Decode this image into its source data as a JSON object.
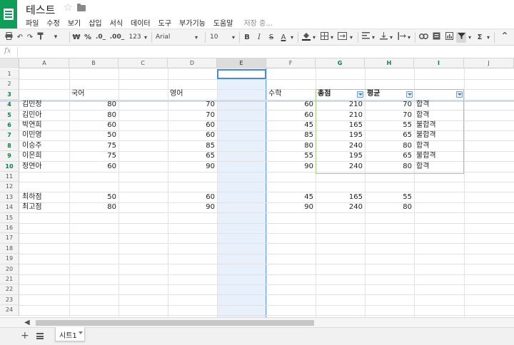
{
  "doc": {
    "title": "테스트"
  },
  "menu": [
    {
      "label": "파일"
    },
    {
      "label": "수정"
    },
    {
      "label": "보기"
    },
    {
      "label": "삽입"
    },
    {
      "label": "서식"
    },
    {
      "label": "데이터"
    },
    {
      "label": "도구"
    },
    {
      "label": "부가기능"
    },
    {
      "label": "도움말"
    }
  ],
  "status": "저장 중...",
  "toolbar": {
    "currency": "₩",
    "percent": "%",
    "dec_decrease": ".0_",
    "dec_increase": ".00_",
    "format_more": "123",
    "font": "Arial",
    "size": "10",
    "bold": "B",
    "italic": "I",
    "strike": "S",
    "text_color": "A",
    "sum": "Σ"
  },
  "formula": {
    "fx": "fx",
    "value": ""
  },
  "columns": [
    "A",
    "B",
    "C",
    "D",
    "E",
    "F",
    "G",
    "H",
    "I",
    "J"
  ],
  "rows": [
    "1",
    "2",
    "3",
    "4",
    "5",
    "6",
    "7",
    "8",
    "9",
    "10",
    "11",
    "12",
    "13",
    "14",
    "15",
    "16",
    "17",
    "18",
    "19",
    "20",
    "21",
    "22",
    "23",
    "24"
  ],
  "headers": {
    "korean": "국어",
    "english": "영어",
    "math": "수학",
    "total": "총점",
    "average": "평균"
  },
  "students": [
    {
      "name": "김민정",
      "korean": "80",
      "english": "70",
      "math": "60",
      "total": "210",
      "average": "70",
      "result": "합격"
    },
    {
      "name": "김민아",
      "korean": "80",
      "english": "70",
      "math": "60",
      "total": "210",
      "average": "70",
      "result": "합격"
    },
    {
      "name": "박연희",
      "korean": "60",
      "english": "60",
      "math": "45",
      "total": "165",
      "average": "55",
      "result": "불합격"
    },
    {
      "name": "이민영",
      "korean": "50",
      "english": "60",
      "math": "85",
      "total": "195",
      "average": "65",
      "result": "불합격"
    },
    {
      "name": "이승주",
      "korean": "75",
      "english": "85",
      "math": "80",
      "total": "240",
      "average": "80",
      "result": "합격"
    },
    {
      "name": "이은희",
      "korean": "75",
      "english": "65",
      "math": "55",
      "total": "195",
      "average": "65",
      "result": "불합격"
    },
    {
      "name": "정연아",
      "korean": "60",
      "english": "90",
      "math": "90",
      "total": "240",
      "average": "80",
      "result": "합격"
    }
  ],
  "stats": [
    {
      "label": "최하점",
      "korean": "50",
      "english": "60",
      "math": "45",
      "total": "165",
      "average": "55"
    },
    {
      "label": "최고점",
      "korean": "80",
      "english": "90",
      "math": "90",
      "total": "240",
      "average": "80"
    }
  ],
  "sheets": [
    {
      "name": "시트1"
    }
  ],
  "colors": {
    "brand": "#0f9d58",
    "selection": "#4a89dc",
    "filter_border": "#9ed37a",
    "filter_header": "#0b8043"
  }
}
